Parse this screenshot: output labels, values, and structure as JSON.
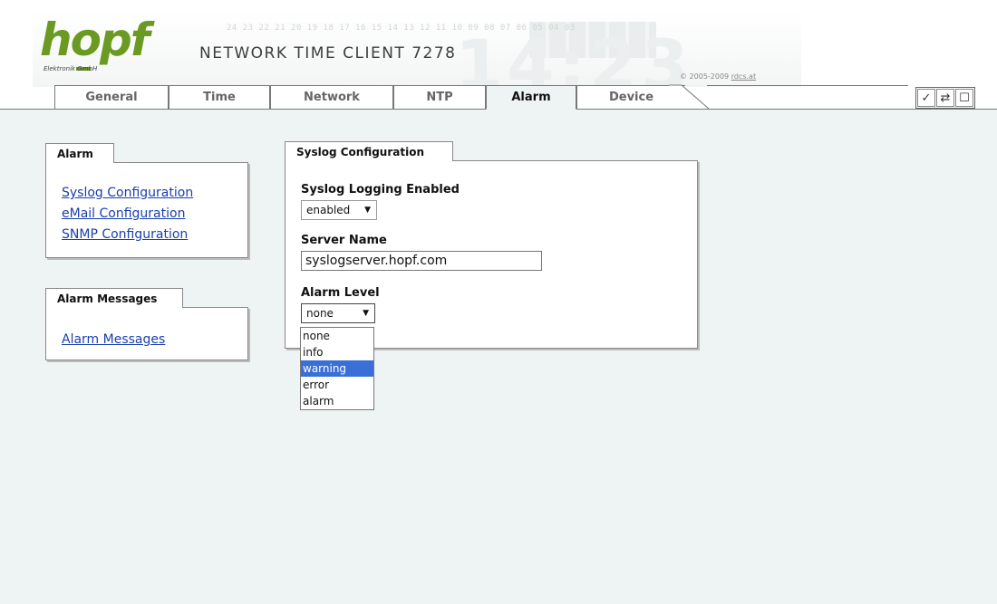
{
  "header": {
    "logo_text": "hopf",
    "logo_subtitle": "Elektronik    GmbH",
    "title": "NETWORK TIME CLIENT 7278",
    "banner_numbers": "24 23 22 21 20 19 18 17 16 15 14 13 12 11 10 09 08 07 06 05 04 03",
    "banner_clock": "14:23",
    "copyright_prefix": "© 2005-2009 ",
    "copyright_link": "rdcs.at"
  },
  "tabs": [
    {
      "label": "General"
    },
    {
      "label": "Time"
    },
    {
      "label": "Network"
    },
    {
      "label": "NTP"
    },
    {
      "label": "Alarm",
      "active": true
    },
    {
      "label": "Device"
    }
  ],
  "toolbar": {
    "icons": [
      "check-icon",
      "reload-icon",
      "save-icon"
    ],
    "glyphs": [
      "✓",
      "⇄",
      "☐"
    ]
  },
  "sidebar": {
    "alarm_panel": {
      "title": "Alarm",
      "links": [
        "Syslog Configuration",
        "eMail Configuration",
        "SNMP Configuration"
      ]
    },
    "messages_panel": {
      "title": "Alarm Messages",
      "links": [
        "Alarm Messages"
      ]
    }
  },
  "syslog": {
    "title": "Syslog Configuration",
    "logging_label": "Syslog Logging Enabled",
    "logging_value": "enabled",
    "server_label": "Server Name",
    "server_value": "syslogserver.hopf.com",
    "level_label": "Alarm Level",
    "level_value": "none",
    "level_options": [
      "none",
      "info",
      "warning",
      "error",
      "alarm"
    ],
    "highlighted_option": "warning"
  },
  "colors": {
    "brand_green": "#6a9a22",
    "content_bg": "#eef4f3",
    "link": "#1a3fae",
    "highlight": "#3a6fd8"
  }
}
